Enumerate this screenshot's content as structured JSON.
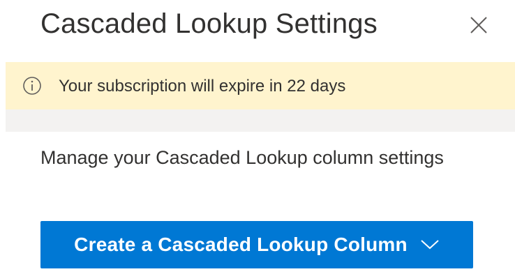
{
  "panel": {
    "title": "Cascaded Lookup Settings",
    "close_icon": "close-icon"
  },
  "banner": {
    "icon": "info-icon",
    "message": "Your subscription will expire in 22 days",
    "background_color": "#fff4ce"
  },
  "main": {
    "description": "Manage your Cascaded Lookup column settings",
    "create_button": {
      "label": "Create a Cascaded Lookup Column",
      "icon": "chevron-down-icon",
      "background_color": "#0078d4"
    }
  }
}
